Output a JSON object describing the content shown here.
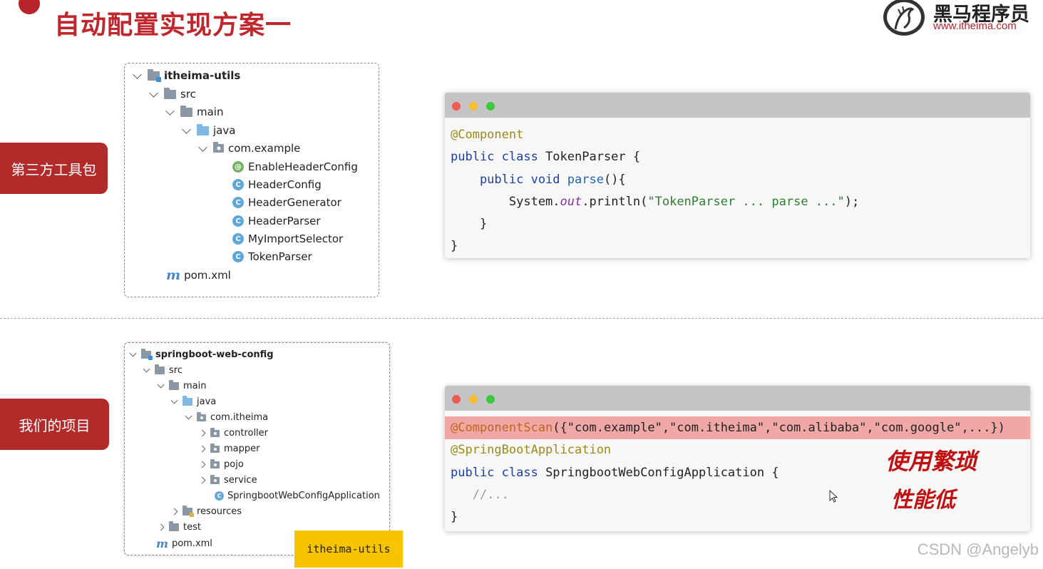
{
  "slide": {
    "title": "自动配置实现方案一"
  },
  "logo": {
    "brand": "黑马程序员",
    "url": "www.itheima.com"
  },
  "labels": {
    "third_party": "第三方工具包",
    "our_project": "我们的项目"
  },
  "tree_top": {
    "root": "itheima-utils",
    "src": "src",
    "main": "main",
    "java": "java",
    "package": "com.example",
    "files": [
      {
        "name": "EnableHeaderConfig",
        "kind": "annotation",
        "icon": "@"
      },
      {
        "name": "HeaderConfig",
        "kind": "class",
        "icon": "C"
      },
      {
        "name": "HeaderGenerator",
        "kind": "class",
        "icon": "C"
      },
      {
        "name": "HeaderParser",
        "kind": "class",
        "icon": "C"
      },
      {
        "name": "MyImportSelector",
        "kind": "class",
        "icon": "C"
      },
      {
        "name": "TokenParser",
        "kind": "class",
        "icon": "C"
      }
    ],
    "pom": "pom.xml",
    "pom_icon": "m"
  },
  "tree_bottom": {
    "root": "springboot-web-config",
    "src": "src",
    "main": "main",
    "java": "java",
    "package": "com.itheima",
    "subfolders": [
      "controller",
      "mapper",
      "pojo",
      "service"
    ],
    "app_class": "SpringbootWebConfigApplication",
    "resources": "resources",
    "test": "test",
    "pom": "pom.xml",
    "pom_icon": "m"
  },
  "code_top": {
    "l1_ann": "@Component",
    "l2_kw": "public class ",
    "l2_name": "TokenParser {",
    "l3_kw": "    public void ",
    "l3_fn": "parse",
    "l3_rest": "(){",
    "l4_a": "        System.",
    "l4_fld": "out",
    "l4_b": ".println(",
    "l4_str": "\"TokenParser ... parse ...\"",
    "l4_c": ");",
    "l5": "    }",
    "l6": "}"
  },
  "code_bottom": {
    "l1_ann": "@ComponentScan",
    "l1_rest": "({\"com.example\",\"com.itheima\",\"com.alibaba\",\"com.google\",...})",
    "l2_ann": "@SpringBootApplication",
    "l3_kw": "public class ",
    "l3_name": "SpringbootWebConfigApplication {",
    "l4_cmt": "   //...",
    "l5": "}"
  },
  "handwriting": {
    "line1": "使用繁琐",
    "line2": "性能低"
  },
  "tag": "itheima-utils",
  "watermark": "CSDN @Angelyb",
  "colors": {
    "brand_red": "#c0262b",
    "label_red": "#b22a2a",
    "highlight": "#f2a7a7",
    "tag_yellow": "#f8c400",
    "traffic_red": "#ef5a52",
    "traffic_yellow": "#f6be2e",
    "traffic_green": "#3ec63e"
  }
}
